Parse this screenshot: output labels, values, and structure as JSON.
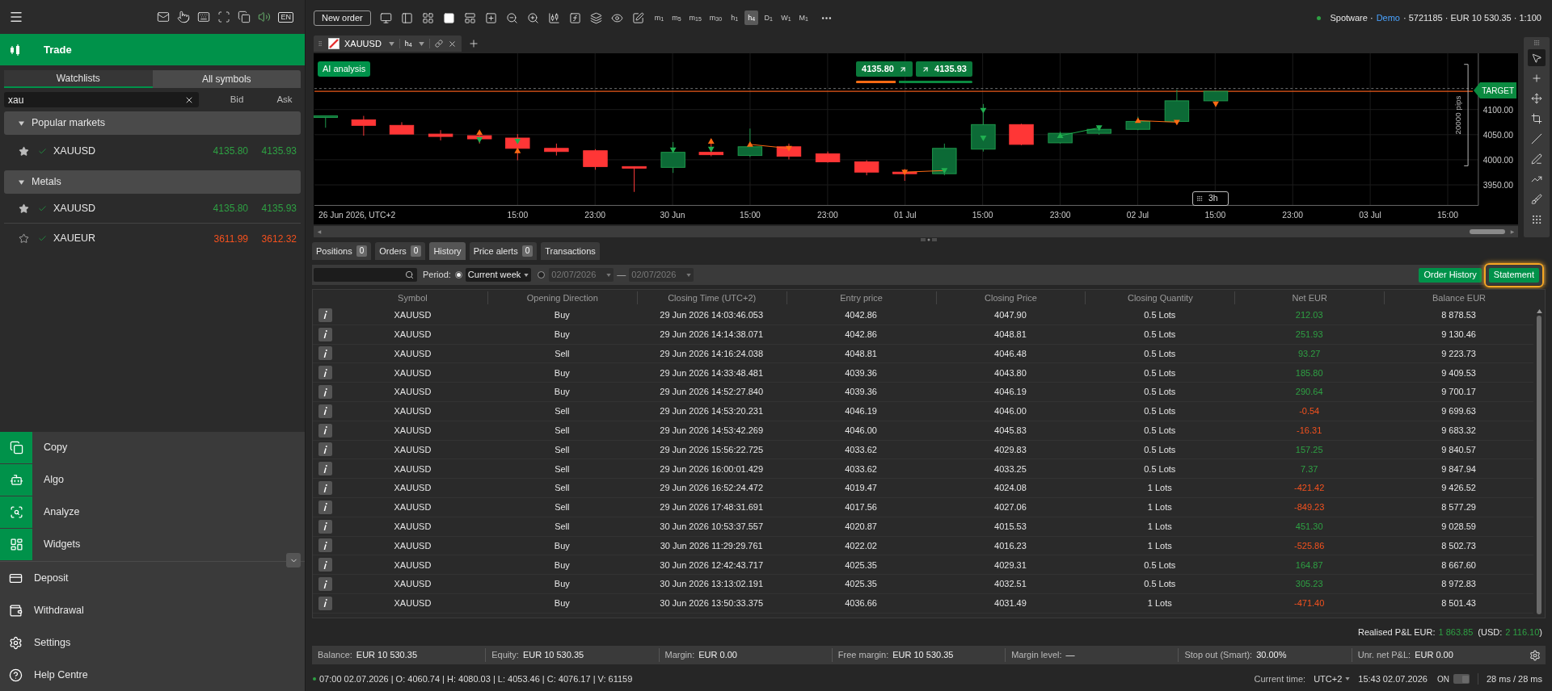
{
  "sidebar": {
    "language": "EN",
    "section": {
      "label": "Trade",
      "selected": true
    },
    "tabs": [
      {
        "label": "Watchlists",
        "selected": true
      },
      {
        "label": "All symbols",
        "selected": false
      }
    ],
    "search": {
      "value": "xau"
    },
    "columns": [
      "Bid",
      "Ask"
    ],
    "groups": [
      {
        "label": "Popular markets",
        "expanded": true,
        "symbols": [
          {
            "symbol": "XAUUSD",
            "favorite": true,
            "bid": "4135.80",
            "ask": "4135.93",
            "color": "#2ea043"
          }
        ]
      },
      {
        "label": "Metals",
        "expanded": true,
        "symbols": [
          {
            "symbol": "XAUUSD",
            "favorite": true,
            "bid": "4135.80",
            "ask": "4135.93",
            "color": "#2ea043"
          },
          {
            "symbol": "XAUEUR",
            "favorite": false,
            "bid": "3611.99",
            "ask": "3612.32",
            "color": "#f4511e"
          }
        ]
      }
    ],
    "nav": [
      {
        "label": "Copy",
        "kind": "app"
      },
      {
        "label": "Algo",
        "kind": "app"
      },
      {
        "label": "Analyze",
        "kind": "app"
      },
      {
        "label": "Widgets",
        "kind": "app"
      },
      {
        "label": "Deposit",
        "kind": "link"
      },
      {
        "label": "Withdrawal",
        "kind": "link"
      },
      {
        "label": "Settings",
        "kind": "link"
      },
      {
        "label": "Help Centre",
        "kind": "link"
      }
    ]
  },
  "toolbar": {
    "new_order": "New order",
    "layouts": [
      {
        "selected": false
      },
      {
        "selected": true
      },
      {
        "selected": false
      }
    ],
    "timeframes": [
      {
        "label": "m$_{1}$",
        "selected": false
      },
      {
        "label": "m$_{5}$",
        "selected": false
      },
      {
        "label": "m$_{15}$",
        "selected": false
      },
      {
        "label": "m$_{30}$",
        "selected": false
      },
      {
        "label": "h$_{1}$",
        "selected": false
      },
      {
        "label": "h$_{4}$",
        "selected": true
      },
      {
        "label": "D$_{1}$",
        "selected": false
      },
      {
        "label": "W$_{1}$",
        "selected": false
      },
      {
        "label": "M$_{1}$",
        "selected": false
      }
    ],
    "account": {
      "connected": true,
      "broker": "Spotware ·",
      "type": "Demo",
      "details": "· 5721185 · EUR 10 530.35 · 1:100"
    }
  },
  "chart_tab": {
    "symbol": "XAUUSD",
    "timeframe": "h$_{4}$"
  },
  "chart": {
    "ai_button": "AI analysis",
    "sell": "4135.80",
    "buy": "4135.93",
    "quote_bar": {
      "level": 0.37
    },
    "target_label": "TARGET",
    "range_label": "20000 pips",
    "price_ticks": [
      "4100.00",
      "4050.00",
      "4000.00",
      "3950.00"
    ],
    "time_labels": [
      "26 Jun 2026, UTC+2",
      "15:00",
      "23:00",
      "30 Jun",
      "15:00",
      "23:00",
      "01 Jul",
      "15:00",
      "23:00",
      "02 Jul",
      "15:00",
      "23:00",
      "03 Jul",
      "15:00"
    ],
    "tooltip": "3h"
  },
  "drawing_tools": [
    {
      "selected": true
    },
    {
      "selected": false
    },
    {
      "selected": false
    },
    {
      "selected": false
    },
    {
      "selected": false
    },
    {
      "selected": false
    },
    {
      "selected": false
    },
    {
      "selected": false
    },
    {
      "selected": false
    }
  ],
  "panel_tabs": [
    {
      "label": "Positions",
      "count": "0",
      "selected": false
    },
    {
      "label": "Orders",
      "count": "0",
      "selected": false
    },
    {
      "label": "History",
      "selected": true
    },
    {
      "label": "Price alerts",
      "count": "0",
      "selected": false
    },
    {
      "label": "Transactions",
      "selected": false
    }
  ],
  "filter": {
    "label": "Period:",
    "preset": {
      "value": "Current week",
      "selected": true
    },
    "range": {
      "selected": false,
      "from": "02/07/2026",
      "separator": "—",
      "to": "02/07/2026"
    },
    "actions": [
      {
        "label": "Order History",
        "highlighted": false
      },
      {
        "label": "Statement",
        "highlighted": true
      }
    ]
  },
  "table": {
    "columns": [
      "Symbol",
      "Opening Direction",
      "Closing Time (UTC+2)",
      "Entry price",
      "Closing Price",
      "Closing Quantity",
      "Net EUR",
      "Balance EUR"
    ],
    "rows": [
      {
        "symbol": "XAUUSD",
        "direction": "Buy",
        "closing_time": "29 Jun 2026 14:03:46.053",
        "entry_price": "4042.86",
        "closing_price": "4047.90",
        "quantity": "0.5 Lots",
        "net": "212.03",
        "color": "#2ea043",
        "balance": "8 878.53"
      },
      {
        "symbol": "XAUUSD",
        "direction": "Buy",
        "closing_time": "29 Jun 2026 14:14:38.071",
        "entry_price": "4042.86",
        "closing_price": "4048.81",
        "quantity": "0.5 Lots",
        "net": "251.93",
        "color": "#2ea043",
        "balance": "9 130.46"
      },
      {
        "symbol": "XAUUSD",
        "direction": "Sell",
        "closing_time": "29 Jun 2026 14:16:24.038",
        "entry_price": "4048.81",
        "closing_price": "4046.48",
        "quantity": "0.5 Lots",
        "net": "93.27",
        "color": "#2ea043",
        "balance": "9 223.73"
      },
      {
        "symbol": "XAUUSD",
        "direction": "Buy",
        "closing_time": "29 Jun 2026 14:33:48.481",
        "entry_price": "4039.36",
        "closing_price": "4043.80",
        "quantity": "0.5 Lots",
        "net": "185.80",
        "color": "#2ea043",
        "balance": "9 409.53"
      },
      {
        "symbol": "XAUUSD",
        "direction": "Buy",
        "closing_time": "29 Jun 2026 14:52:27.840",
        "entry_price": "4039.36",
        "closing_price": "4046.19",
        "quantity": "0.5 Lots",
        "net": "290.64",
        "color": "#2ea043",
        "balance": "9 700.17"
      },
      {
        "symbol": "XAUUSD",
        "direction": "Sell",
        "closing_time": "29 Jun 2026 14:53:20.231",
        "entry_price": "4046.19",
        "closing_price": "4046.00",
        "quantity": "0.5 Lots",
        "net": "-0.54",
        "color": "#f4511e",
        "balance": "9 699.63"
      },
      {
        "symbol": "XAUUSD",
        "direction": "Sell",
        "closing_time": "29 Jun 2026 14:53:42.269",
        "entry_price": "4046.00",
        "closing_price": "4045.83",
        "quantity": "0.5 Lots",
        "net": "-16.31",
        "color": "#f4511e",
        "balance": "9 683.32"
      },
      {
        "symbol": "XAUUSD",
        "direction": "Sell",
        "closing_time": "29 Jun 2026 15:56:22.725",
        "entry_price": "4033.62",
        "closing_price": "4029.83",
        "quantity": "0.5 Lots",
        "net": "157.25",
        "color": "#2ea043",
        "balance": "9 840.57"
      },
      {
        "symbol": "XAUUSD",
        "direction": "Sell",
        "closing_time": "29 Jun 2026 16:00:01.429",
        "entry_price": "4033.62",
        "closing_price": "4033.25",
        "quantity": "0.5 Lots",
        "net": "7.37",
        "color": "#2ea043",
        "balance": "9 847.94"
      },
      {
        "symbol": "XAUUSD",
        "direction": "Sell",
        "closing_time": "29 Jun 2026 16:52:24.472",
        "entry_price": "4019.47",
        "closing_price": "4024.08",
        "quantity": "1 Lots",
        "net": "-421.42",
        "color": "#f4511e",
        "balance": "9 426.52"
      },
      {
        "symbol": "XAUUSD",
        "direction": "Sell",
        "closing_time": "29 Jun 2026 17:48:31.691",
        "entry_price": "4017.56",
        "closing_price": "4027.06",
        "quantity": "1 Lots",
        "net": "-849.23",
        "color": "#f4511e",
        "balance": "8 577.29"
      },
      {
        "symbol": "XAUUSD",
        "direction": "Sell",
        "closing_time": "30 Jun 2026 10:53:37.557",
        "entry_price": "4020.87",
        "closing_price": "4015.53",
        "quantity": "1 Lots",
        "net": "451.30",
        "color": "#2ea043",
        "balance": "9 028.59"
      },
      {
        "symbol": "XAUUSD",
        "direction": "Buy",
        "closing_time": "30 Jun 2026 11:29:29.761",
        "entry_price": "4022.02",
        "closing_price": "4016.23",
        "quantity": "1 Lots",
        "net": "-525.86",
        "color": "#f4511e",
        "balance": "8 502.73"
      },
      {
        "symbol": "XAUUSD",
        "direction": "Buy",
        "closing_time": "30 Jun 2026 12:42:43.717",
        "entry_price": "4025.35",
        "closing_price": "4029.31",
        "quantity": "0.5 Lots",
        "net": "164.87",
        "color": "#2ea043",
        "balance": "8 667.60"
      },
      {
        "symbol": "XAUUSD",
        "direction": "Buy",
        "closing_time": "30 Jun 2026 13:13:02.191",
        "entry_price": "4025.35",
        "closing_price": "4032.51",
        "quantity": "0.5 Lots",
        "net": "305.23",
        "color": "#2ea043",
        "balance": "8 972.83"
      },
      {
        "symbol": "XAUUSD",
        "direction": "Buy",
        "closing_time": "30 Jun 2026 13:50:33.375",
        "entry_price": "4036.66",
        "closing_price": "4031.49",
        "quantity": "1 Lots",
        "net": "-471.40",
        "color": "#f4511e",
        "balance": "8 501.43"
      }
    ]
  },
  "realised": {
    "label": "Realised P&L EUR:",
    "value": "1 863.85",
    "usd_prefix": "(USD:",
    "usd_value": "2 116.10",
    "usd_suffix": ")"
  },
  "balance_bar": [
    {
      "label": "Balance:",
      "value": "EUR 10 530.35"
    },
    {
      "label": "Equity:",
      "value": "EUR 10 530.35"
    },
    {
      "label": "Margin:",
      "value": "EUR 0.00"
    },
    {
      "label": "Free margin:",
      "value": "EUR 10 530.35"
    },
    {
      "label": "Margin level:",
      "value": "—"
    },
    {
      "label": "Stop out (Smart):",
      "value": "30.00%"
    },
    {
      "label": "Unr. net P&L:",
      "value": "EUR 0.00"
    }
  ],
  "status_bar": {
    "connected": true,
    "ohlc": "07:00 02.07.2026 | O: 4060.74 | H: 4080.03 | L: 4053.46 | C: 4076.17 | V: 61159",
    "time_label": "Current time:",
    "timezone": "UTC+2",
    "time": "15:43 02.07.2026",
    "toggle": {
      "label": "ON",
      "on": true
    },
    "latency": "28 ms / 28 ms"
  }
}
